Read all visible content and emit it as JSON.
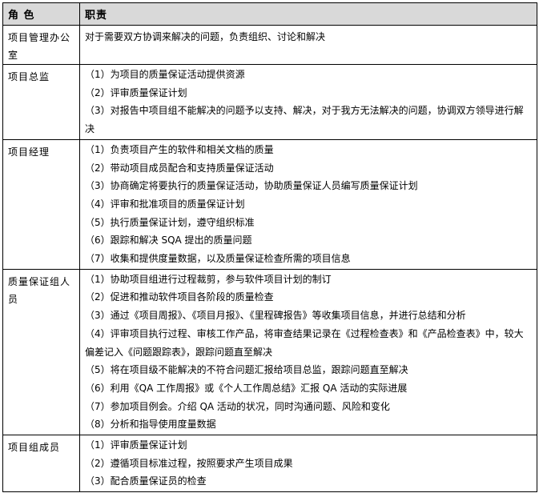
{
  "header": {
    "role": "角 色",
    "resp": "职责"
  },
  "rows": [
    {
      "role": "项目管理办公室",
      "items": [
        "对于需要双方协调来解决的问题，负责组织、讨论和解决"
      ]
    },
    {
      "role": "项目总监",
      "items": [
        "（1）为项目的质量保证活动提供资源",
        "（2）评审质量保证计划",
        "（3）对报告中项目组不能解决的问题予以支持、解决，对于我方无法解决的问题，协调双方领导进行解决"
      ]
    },
    {
      "role": "项目经理",
      "items": [
        "（1）负责项目产生的软件和相关文档的质量",
        "（2）带动项目成员配合和支持质量保证活动",
        "（3）协商确定将要执行的质量保证活动，协助质量保证人员编写质量保证计划",
        "（4）评审和批准项目的质量保证计划",
        "（5）执行质量保证计划，遵守组织标准",
        "（6）跟踪和解决 SQA 提出的质量问题",
        "（7）收集和提供度量数据，以及质量保证检查所需的项目信息"
      ]
    },
    {
      "role": "质量保证组人员",
      "items": [
        "（1）协助项目组进行过程裁剪，参与软件项目计划的制订",
        "（2）促进和推动软件项目各阶段的质量检查",
        "（3）通过《项目周报》、《项目月报》、《里程碑报告》等收集项目信息，并进行总结和分析",
        "（4）评审项目执行过程、审核工作产品，将审查结果记录在《过程检查表》和《产品检查表》中，较大偏差记入《问题跟踪表》，跟踪问题直至解决",
        "（5）将在项目级不能解决的不符合问题汇报给项目总监，跟踪问题直至解决",
        "（6）利用《QA 工作周报》或《个人工作周总结》汇报 QA 活动的实际进展",
        "（7）参加项目例会。介绍 QA 活动的状况，同时沟通问题、风险和变化",
        "（8）分析和指导使用度量数据"
      ]
    },
    {
      "role": "项目组成员",
      "items": [
        "（1）评审质量保证计划",
        "（2）遵循项目标准过程，按照要求产生项目成果",
        "（3）配合质量保证员的检查"
      ]
    }
  ]
}
